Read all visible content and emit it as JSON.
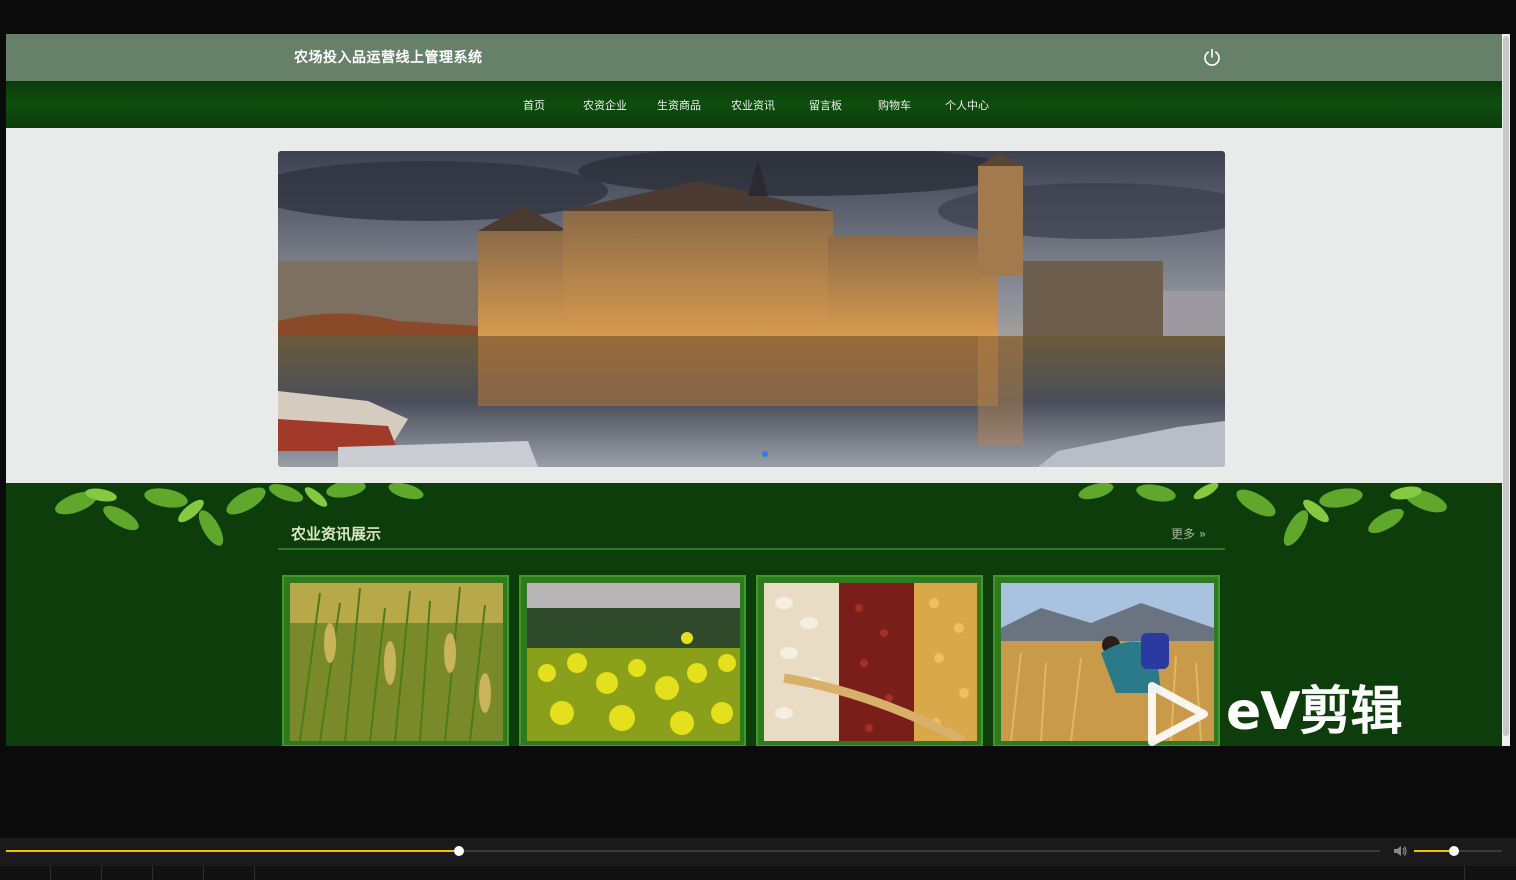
{
  "site": {
    "title": "农场投入品运营线上管理系统"
  },
  "nav": [
    {
      "label": "首页"
    },
    {
      "label": "农资企业"
    },
    {
      "label": "生资商品"
    },
    {
      "label": "农业资讯"
    },
    {
      "label": "留言板"
    },
    {
      "label": "购物车"
    },
    {
      "label": "个人中心"
    }
  ],
  "carousel": {
    "slide_count": 1,
    "active_index": 0
  },
  "news": {
    "title": "农业资讯展示",
    "more": "更多 »",
    "items": [
      {
        "image": "rice-field"
      },
      {
        "image": "rapeseed-field"
      },
      {
        "image": "beans-and-grains"
      },
      {
        "image": "wheat-harvest"
      }
    ]
  },
  "player": {
    "progress": 0.33,
    "volume": 0.45
  },
  "watermark": {
    "brand": "eV剪辑"
  },
  "colors": {
    "topbar": "#67806a",
    "nav": "#0e4e0e",
    "news_bg": "#0d3d0a",
    "accent": "#f2c100"
  }
}
